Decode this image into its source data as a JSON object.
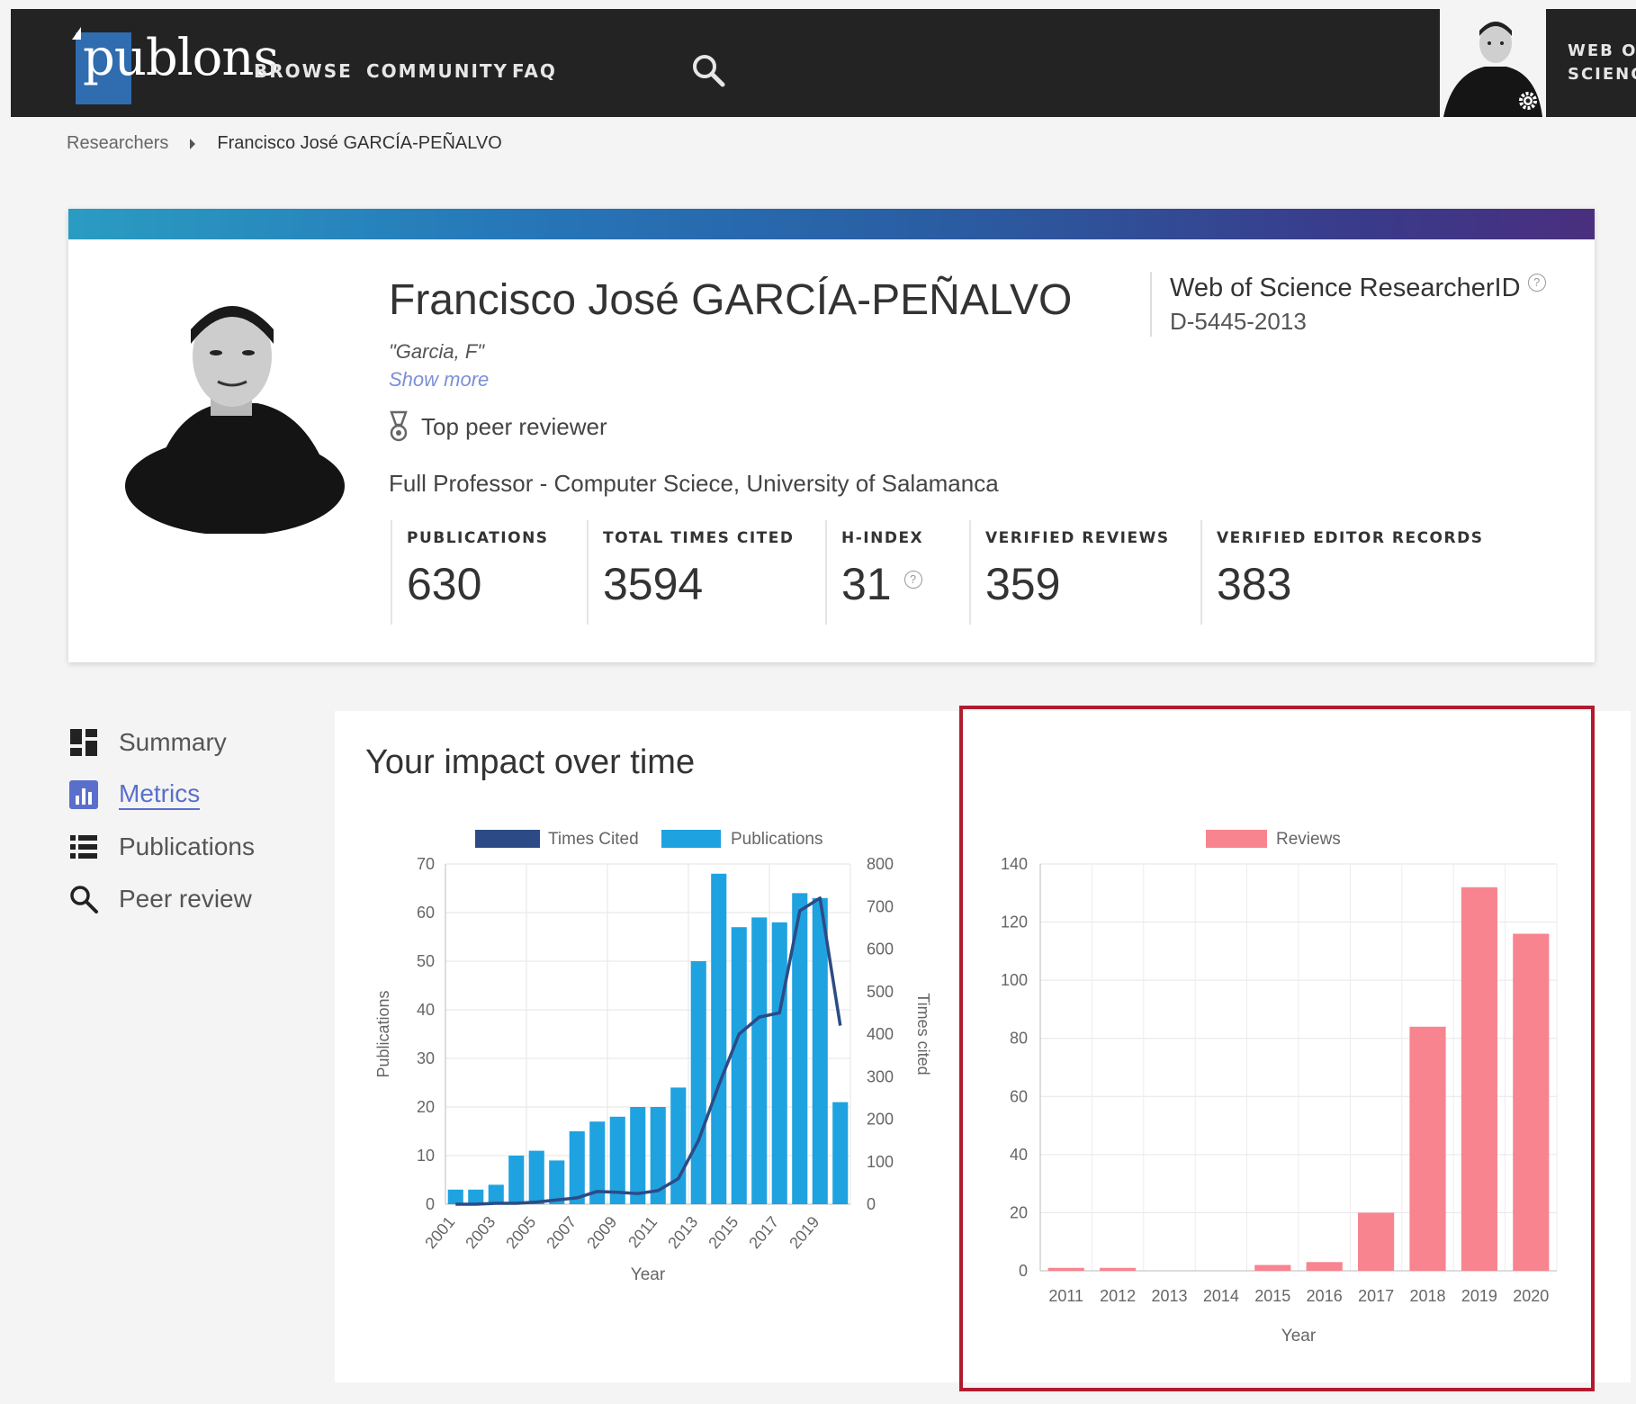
{
  "nav": {
    "logo": "publons",
    "items": [
      "BROWSE",
      "COMMUNITY",
      "FAQ"
    ],
    "wos_line1": "WEB OF",
    "wos_line2": "SCIENCE"
  },
  "breadcrumb": {
    "parent": "Researchers",
    "current": "Francisco José GARCÍA-PEÑALVO"
  },
  "profile": {
    "name": "Francisco José GARCÍA-PEÑALVO",
    "alias": "\"Garcia, F\"",
    "show_more": "Show more",
    "award": "Top peer reviewer",
    "affiliation": "Full Professor - Computer Sciece, University of Salamanca",
    "researcherid_label": "Web of Science ResearcherID",
    "researcherid_value": "D-5445-2013"
  },
  "stats": [
    {
      "label": "PUBLICATIONS",
      "value": "630"
    },
    {
      "label": "TOTAL TIMES CITED",
      "value": "3594"
    },
    {
      "label": "H-INDEX",
      "value": "31"
    },
    {
      "label": "VERIFIED REVIEWS",
      "value": "359"
    },
    {
      "label": "VERIFIED EDITOR RECORDS",
      "value": "383"
    }
  ],
  "sidebar": {
    "items": [
      {
        "label": "Summary",
        "icon": "dashboard-icon"
      },
      {
        "label": "Metrics",
        "icon": "bar-chart-icon",
        "active": true
      },
      {
        "label": "Publications",
        "icon": "list-icon"
      },
      {
        "label": "Peer review",
        "icon": "search-icon"
      }
    ]
  },
  "main": {
    "title": "Your impact over time"
  },
  "colors": {
    "publications": "#1fa2e0",
    "times_cited": "#2c4b86",
    "reviews": "#f7848f",
    "highlight": "#b01c2e"
  },
  "chart_data": [
    {
      "type": "bar",
      "legend": [
        "Times Cited",
        "Publications"
      ],
      "x": [
        2001,
        2002,
        2003,
        2004,
        2005,
        2006,
        2007,
        2008,
        2009,
        2010,
        2011,
        2012,
        2013,
        2014,
        2015,
        2016,
        2017,
        2018,
        2019,
        2020
      ],
      "x_tick_labels": [
        "2001",
        "2003",
        "2005",
        "2007",
        "2009",
        "2011",
        "2013",
        "2015",
        "2017",
        "2019"
      ],
      "xlabel": "Year",
      "ylabel_left": "Publications",
      "ylabel_right": "Times cited",
      "ylim_left": [
        0,
        70
      ],
      "ylim_right": [
        0,
        800
      ],
      "yticks_left": [
        "0",
        "10",
        "20",
        "30",
        "40",
        "50",
        "60",
        "70"
      ],
      "yticks_right": [
        "0",
        "100",
        "200",
        "300",
        "400",
        "500",
        "600",
        "700",
        "800"
      ],
      "series": [
        {
          "name": "Publications",
          "type": "bar",
          "axis": "left",
          "values": [
            3,
            3,
            4,
            10,
            11,
            9,
            15,
            17,
            18,
            20,
            20,
            24,
            50,
            68,
            57,
            59,
            58,
            64,
            63,
            21
          ]
        },
        {
          "name": "Times Cited",
          "type": "line",
          "axis": "right",
          "values": [
            0,
            0,
            2,
            2,
            5,
            10,
            15,
            30,
            28,
            25,
            32,
            60,
            150,
            280,
            400,
            440,
            450,
            690,
            720,
            420
          ]
        }
      ],
      "grid": true,
      "legend_position": "top"
    },
    {
      "type": "bar",
      "legend": [
        "Reviews"
      ],
      "categories": [
        "2011",
        "2012",
        "2013",
        "2014",
        "2015",
        "2016",
        "2017",
        "2018",
        "2019",
        "2020"
      ],
      "xlabel": "Year",
      "ylim": [
        0,
        140
      ],
      "yticks": [
        "0",
        "20",
        "40",
        "60",
        "80",
        "100",
        "120",
        "140"
      ],
      "series": [
        {
          "name": "Reviews",
          "values": [
            1,
            1,
            0,
            0,
            2,
            3,
            20,
            84,
            132,
            116
          ]
        }
      ],
      "grid": true,
      "legend_position": "top"
    }
  ]
}
